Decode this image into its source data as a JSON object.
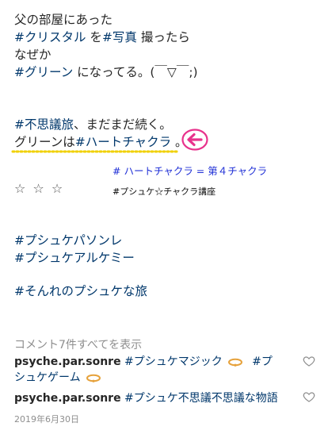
{
  "caption": {
    "line1": "父の部屋にあった",
    "line2": {
      "tag1": "#クリスタル",
      "mid": " を",
      "tag2": "#写真",
      "tail": " 撮ったら"
    },
    "line3": "なぜか",
    "line4": {
      "tag": "#グリーン",
      "tail": " になってる。(￣▽￣;)"
    },
    "line5": {
      "tag": "#不思議旅",
      "tail": "、まだまだ続く。"
    },
    "line6": {
      "head": "グリーンは",
      "tag": "#ハートチャクラ",
      "tail": " 。"
    }
  },
  "annotation": {
    "line1": "# ハートチャクラ = 第４チャクラ",
    "stars": "☆ ☆ ☆",
    "line2": "#プシュケ☆チャクラ講座",
    "underline_color": "#f0d000",
    "arrow_color": "#e8328c"
  },
  "hashtags": [
    "#プシュケパソンレ",
    "#プシュケアルケミー",
    "#そんれのプシュケな旅"
  ],
  "view_comments": "コメント7件すべてを表示",
  "comments": [
    {
      "user": "psyche.par.sonre",
      "tag1": "#プシュケマジック",
      "tag2": "#プ",
      "tag2_cont": "シュケゲーム"
    },
    {
      "user": "psyche.par.sonre",
      "text": "#プシュケ不思議不思議な物語"
    }
  ],
  "date": "2019年6月30日"
}
